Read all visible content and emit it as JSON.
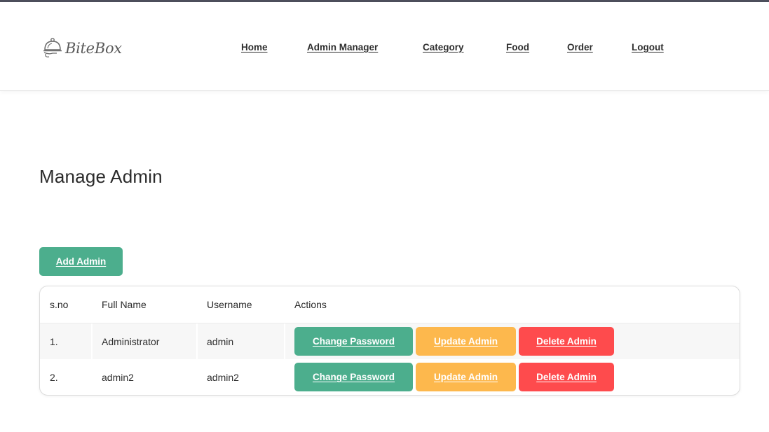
{
  "brand": {
    "name": "BiteBox",
    "icon": "cloche-icon"
  },
  "nav": {
    "items": [
      {
        "label": "Home",
        "key": "home"
      },
      {
        "label": "Admin Manager",
        "key": "admin-manager"
      },
      {
        "label": "Category",
        "key": "category"
      },
      {
        "label": "Food",
        "key": "food"
      },
      {
        "label": "Order",
        "key": "order"
      },
      {
        "label": "Logout",
        "key": "logout"
      }
    ]
  },
  "page": {
    "title": "Manage Admin",
    "add_button": "Add Admin"
  },
  "table": {
    "headers": [
      "s.no",
      "Full Name",
      "Username",
      "Actions"
    ],
    "rows": [
      {
        "sno": "1.",
        "full_name": "Administrator",
        "username": "admin"
      },
      {
        "sno": "2.",
        "full_name": "admin2",
        "username": "admin2"
      }
    ],
    "actions": {
      "change_password": "Change Password",
      "update_admin": "Update Admin",
      "delete_admin": "Delete Admin"
    }
  },
  "colors": {
    "green": "#4cae8d",
    "orange": "#fdb84d",
    "red": "#fe4b4d",
    "text": "#2f2f2f"
  }
}
